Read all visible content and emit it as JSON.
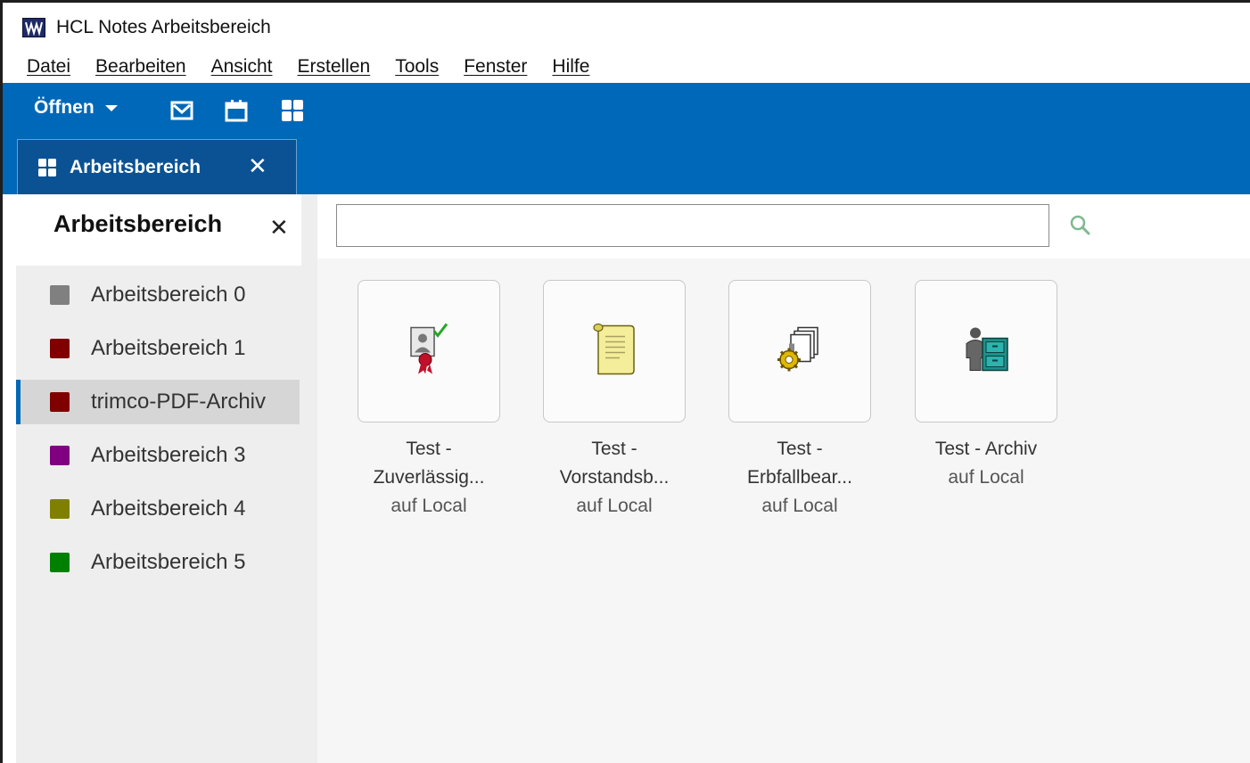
{
  "window": {
    "title": "HCL Notes Arbeitsbereich",
    "app_icon": "hcl-notes-icon"
  },
  "menu": {
    "items": [
      "Datei",
      "Bearbeiten",
      "Ansicht",
      "Erstellen",
      "Tools",
      "Fenster",
      "Hilfe"
    ]
  },
  "toolbar": {
    "open_label": "Öffnen",
    "icons": [
      "mail-icon",
      "calendar-icon",
      "workspace-grid-icon"
    ],
    "accent": "#0068b8"
  },
  "tab": {
    "label": "Arbeitsbereich",
    "icon": "workspace-grid-icon",
    "close_glyph": "✕"
  },
  "sidebar": {
    "title": "Arbeitsbereich",
    "close_glyph": "✕",
    "items": [
      {
        "label": "Arbeitsbereich 0",
        "color": "#808080",
        "selected": false
      },
      {
        "label": "Arbeitsbereich 1",
        "color": "#800000",
        "selected": false
      },
      {
        "label": "trimco-PDF-Archiv",
        "color": "#800000",
        "selected": true
      },
      {
        "label": "Arbeitsbereich 3",
        "color": "#800080",
        "selected": false
      },
      {
        "label": "Arbeitsbereich 4",
        "color": "#808000",
        "selected": false
      },
      {
        "label": "Arbeitsbereich 5",
        "color": "#008000",
        "selected": false
      }
    ]
  },
  "search": {
    "value": "",
    "icon": "search-icon"
  },
  "tiles": [
    {
      "line1": "Test -",
      "line2": "Zuverlässig...",
      "location": "auf Local",
      "icon": "certificate-user-icon"
    },
    {
      "line1": "Test -",
      "line2": "Vorstandsb...",
      "location": "auf Local",
      "icon": "document-scroll-icon"
    },
    {
      "line1": "Test -",
      "line2": "Erbfallbear...",
      "location": "auf Local",
      "icon": "documents-gear-icon"
    },
    {
      "line1": "Test - Archiv",
      "line2": "",
      "location": "auf Local",
      "icon": "person-filing-cabinet-icon"
    }
  ]
}
